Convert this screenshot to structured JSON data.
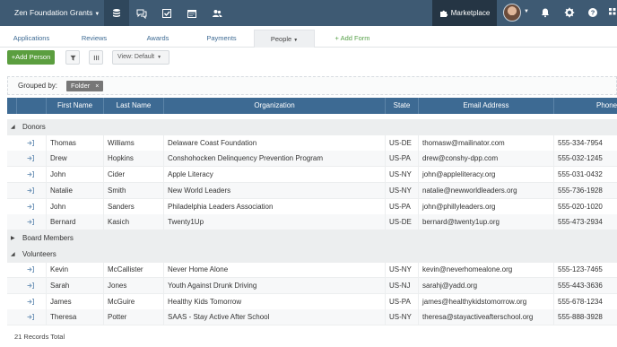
{
  "app": {
    "title": "Zen Foundation Grants"
  },
  "topnav": {
    "icons": [
      "database-icon",
      "chat-icon",
      "check-square-icon",
      "calendar-icon",
      "users-icon"
    ],
    "marketplace_label": "Marketplace",
    "right_icons": [
      "bell-icon",
      "gear-icon",
      "help-icon",
      "grid-icon"
    ]
  },
  "tabs": [
    {
      "label": "Applications"
    },
    {
      "label": "Reviews"
    },
    {
      "label": "Awards"
    },
    {
      "label": "Payments"
    },
    {
      "label": "People"
    },
    {
      "label": "Add Form"
    }
  ],
  "toolbar": {
    "add_person_label": "+Add Person",
    "view_label": "View: Default"
  },
  "grouping": {
    "label": "Grouped by:",
    "chip": "Folder"
  },
  "table": {
    "columns": [
      "First Name",
      "Last Name",
      "Organization",
      "State",
      "Email Address",
      "Phone"
    ],
    "groups": [
      {
        "name": "Donors",
        "expanded": true,
        "rows": [
          [
            "Thomas",
            "Williams",
            "Delaware Coast Foundation",
            "US-DE",
            "thomasw@mailinator.com",
            "555-334-7954"
          ],
          [
            "Drew",
            "Hopkins",
            "Conshohocken Delinquency Prevention Program",
            "US-PA",
            "drew@conshy-dpp.com",
            "555-032-1245"
          ],
          [
            "John",
            "Cider",
            "Apple Literacy",
            "US-NY",
            "john@appleliteracy.org",
            "555-031-0432"
          ],
          [
            "Natalie",
            "Smith",
            "New World Leaders",
            "US-NY",
            "natalie@newworldleaders.org",
            "555-736-1928"
          ],
          [
            "John",
            "Sanders",
            "Philadelphia Leaders Association",
            "US-PA",
            "john@phillyleaders.org",
            "555-020-1020"
          ],
          [
            "Bernard",
            "Kasich",
            "Twenty1Up",
            "US-DE",
            "bernard@twenty1up.org",
            "555-473-2934"
          ]
        ]
      },
      {
        "name": "Board Members",
        "expanded": false,
        "rows": []
      },
      {
        "name": "Volunteers",
        "expanded": true,
        "rows": [
          [
            "Kevin",
            "McCallister",
            "Never Home Alone",
            "US-NY",
            "kevin@neverhomealone.org",
            "555-123-7465"
          ],
          [
            "Sarah",
            "Jones",
            "Youth Against Drunk Driving",
            "US-NJ",
            "sarahj@yadd.org",
            "555-443-3636"
          ],
          [
            "James",
            "McGuire",
            "Healthy Kids Tomorrow",
            "US-PA",
            "james@healthykidstomorrow.org",
            "555-678-1234"
          ],
          [
            "Theresa",
            "Potter",
            "SAAS - Stay Active After School",
            "US-NY",
            "theresa@stayactiveafterschool.org",
            "555-888-3928"
          ]
        ]
      }
    ]
  },
  "footer": {
    "total": "21 Records Total"
  },
  "colors": {
    "topbar": "#3e5a73",
    "header": "#3d6a93",
    "add_button": "#5b9e3f",
    "link": "#3d6a93"
  }
}
